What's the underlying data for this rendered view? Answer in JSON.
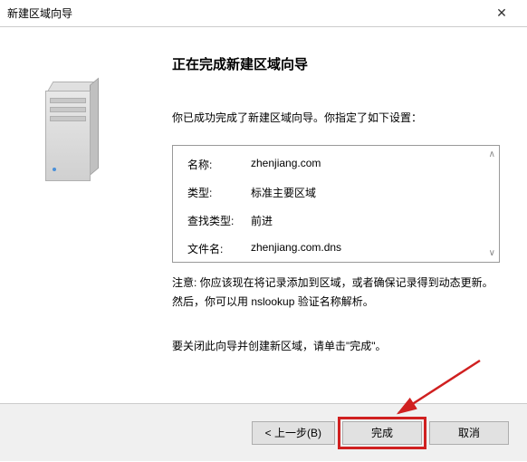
{
  "window": {
    "title": "新建区域向导"
  },
  "heading": "正在完成新建区域向导",
  "intro": "你已成功完成了新建区域向导。你指定了如下设置：",
  "info": {
    "rows": [
      {
        "label": "名称:",
        "value": "zhenjiang.com"
      },
      {
        "label": "类型:",
        "value": "标准主要区域"
      },
      {
        "label": "查找类型:",
        "value": "前进"
      },
      {
        "label": "文件名:",
        "value": "zhenjiang.com.dns"
      }
    ]
  },
  "note": "注意: 你应该现在将记录添加到区域，或者确保记录得到动态更新。然后，你可以用 nslookup 验证名称解析。",
  "final": "要关闭此向导并创建新区域，请单击\"完成\"。",
  "buttons": {
    "back": "< 上一步(B)",
    "finish": "完成",
    "cancel": "取消"
  }
}
